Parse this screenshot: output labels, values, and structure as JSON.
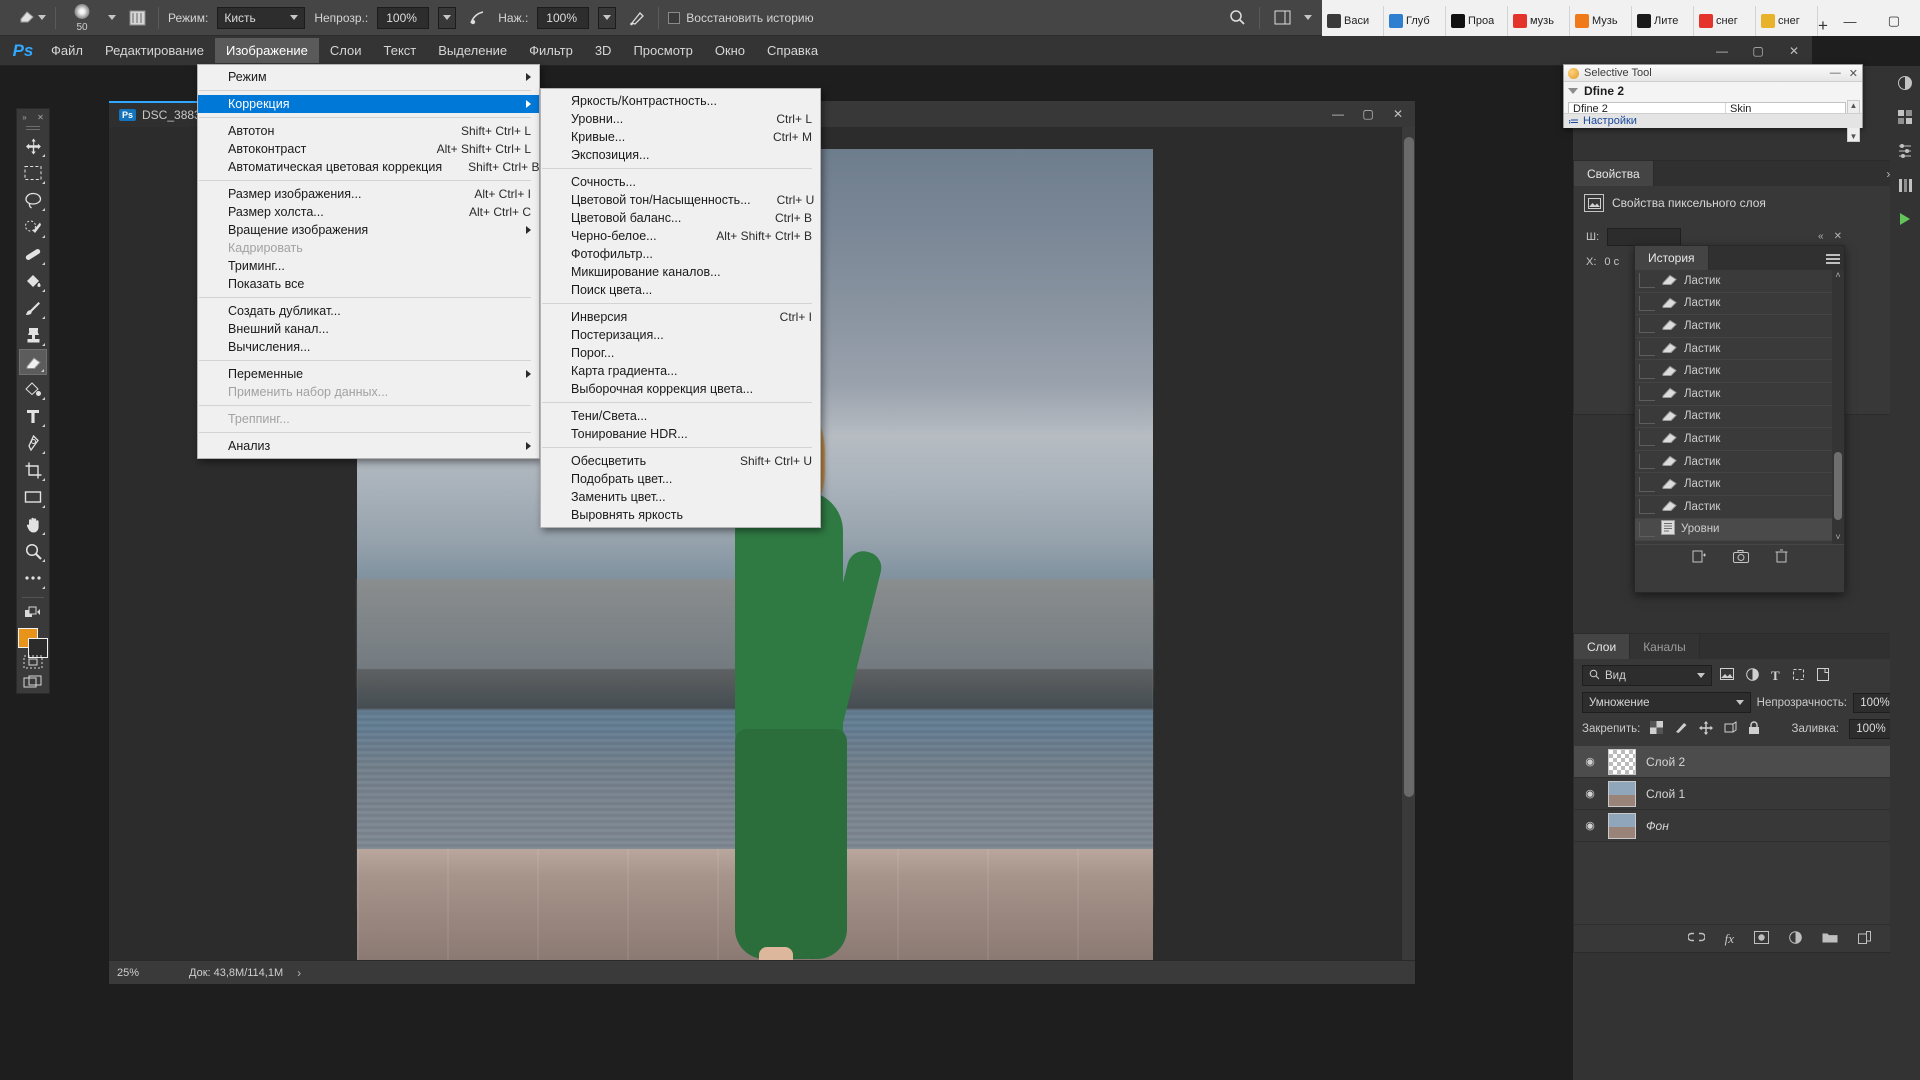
{
  "browser": {
    "tabs": [
      {
        "label": "Васи",
        "color": "#3a3a3a"
      },
      {
        "label": "Глуб",
        "color": "#2f7fd0"
      },
      {
        "label": "Проа",
        "color": "#111111"
      },
      {
        "label": "музь",
        "color": "#e4332a"
      },
      {
        "label": "Музь",
        "color": "#f07a1a"
      },
      {
        "label": "Лите",
        "color": "#1a1a1a"
      },
      {
        "label": "снег",
        "color": "#e4332a"
      },
      {
        "label": "снег",
        "color": "#e8b22a"
      }
    ],
    "new_tab": "+",
    "minimize": "—",
    "maximize": "▢",
    "close": "✕"
  },
  "options_bar": {
    "tool_icon": "eraser-tool-icon",
    "brush_size": "50",
    "mode_label": "Режим:",
    "mode_value": "Кисть",
    "opacity_label": "Непрозр.:",
    "opacity_value": "100%",
    "pressure_opacity_icon": "pressure-opacity-icon",
    "flow_label": "Наж.:",
    "flow_value": "100%",
    "airbrush_icon": "airbrush-icon",
    "restore_history_label": "Восстановить историю",
    "search_icon": "search-icon",
    "workspace_icon": "workspace-icon"
  },
  "menubar": {
    "logo": "Ps",
    "items": [
      "Файл",
      "Редактирование",
      "Изображение",
      "Слои",
      "Текст",
      "Выделение",
      "Фильтр",
      "3D",
      "Просмотр",
      "Окно",
      "Справка"
    ],
    "active_index": 2,
    "window_buttons": [
      "—",
      "▢",
      "✕"
    ]
  },
  "image_menu": {
    "groups": [
      [
        {
          "label": "Режим",
          "shortcut": "",
          "submenu": true,
          "disabled": false,
          "highlighted": false
        }
      ],
      [
        {
          "label": "Коррекция",
          "shortcut": "",
          "submenu": true,
          "disabled": false,
          "highlighted": true
        }
      ],
      [
        {
          "label": "Автотон",
          "shortcut": "Shift+ Ctrl+ L",
          "submenu": false,
          "disabled": false,
          "highlighted": false
        },
        {
          "label": "Автоконтраст",
          "shortcut": "Alt+ Shift+ Ctrl+ L",
          "submenu": false,
          "disabled": false,
          "highlighted": false
        },
        {
          "label": "Автоматическая цветовая коррекция",
          "shortcut": "Shift+ Ctrl+ B",
          "submenu": false,
          "disabled": false,
          "highlighted": false
        }
      ],
      [
        {
          "label": "Размер изображения...",
          "shortcut": "Alt+ Ctrl+ I",
          "submenu": false,
          "disabled": false,
          "highlighted": false
        },
        {
          "label": "Размер холста...",
          "shortcut": "Alt+ Ctrl+ C",
          "submenu": false,
          "disabled": false,
          "highlighted": false
        },
        {
          "label": "Вращение изображения",
          "shortcut": "",
          "submenu": true,
          "disabled": false,
          "highlighted": false
        },
        {
          "label": "Кадрировать",
          "shortcut": "",
          "submenu": false,
          "disabled": true,
          "highlighted": false
        },
        {
          "label": "Триминг...",
          "shortcut": "",
          "submenu": false,
          "disabled": false,
          "highlighted": false
        },
        {
          "label": "Показать все",
          "shortcut": "",
          "submenu": false,
          "disabled": false,
          "highlighted": false
        }
      ],
      [
        {
          "label": "Создать дубликат...",
          "shortcut": "",
          "submenu": false,
          "disabled": false,
          "highlighted": false
        },
        {
          "label": "Внешний канал...",
          "shortcut": "",
          "submenu": false,
          "disabled": false,
          "highlighted": false
        },
        {
          "label": "Вычисления...",
          "shortcut": "",
          "submenu": false,
          "disabled": false,
          "highlighted": false
        }
      ],
      [
        {
          "label": "Переменные",
          "shortcut": "",
          "submenu": true,
          "disabled": false,
          "highlighted": false
        },
        {
          "label": "Применить набор данных...",
          "shortcut": "",
          "submenu": false,
          "disabled": true,
          "highlighted": false
        }
      ],
      [
        {
          "label": "Треппинг...",
          "shortcut": "",
          "submenu": false,
          "disabled": true,
          "highlighted": false
        }
      ],
      [
        {
          "label": "Анализ",
          "shortcut": "",
          "submenu": true,
          "disabled": false,
          "highlighted": false
        }
      ]
    ]
  },
  "adjustments_submenu": {
    "groups": [
      [
        {
          "label": "Яркость/Контрастность...",
          "shortcut": ""
        },
        {
          "label": "Уровни...",
          "shortcut": "Ctrl+ L"
        },
        {
          "label": "Кривые...",
          "shortcut": "Ctrl+ M"
        },
        {
          "label": "Экспозиция...",
          "shortcut": ""
        }
      ],
      [
        {
          "label": "Сочность...",
          "shortcut": ""
        },
        {
          "label": "Цветовой тон/Насыщенность...",
          "shortcut": "Ctrl+ U"
        },
        {
          "label": "Цветовой баланс...",
          "shortcut": "Ctrl+ B"
        },
        {
          "label": "Черно-белое...",
          "shortcut": "Alt+ Shift+ Ctrl+ B"
        },
        {
          "label": "Фотофильтр...",
          "shortcut": ""
        },
        {
          "label": "Микширование каналов...",
          "shortcut": ""
        },
        {
          "label": "Поиск цвета...",
          "shortcut": ""
        }
      ],
      [
        {
          "label": "Инверсия",
          "shortcut": "Ctrl+ I"
        },
        {
          "label": "Постеризация...",
          "shortcut": ""
        },
        {
          "label": "Порог...",
          "shortcut": ""
        },
        {
          "label": "Карта градиента...",
          "shortcut": ""
        },
        {
          "label": "Выборочная коррекция цвета...",
          "shortcut": ""
        }
      ],
      [
        {
          "label": "Тени/Света...",
          "shortcut": ""
        },
        {
          "label": "Тонирование HDR...",
          "shortcut": ""
        }
      ],
      [
        {
          "label": "Обесцветить",
          "shortcut": "Shift+ Ctrl+ U"
        },
        {
          "label": "Подобрать цвет...",
          "shortcut": ""
        },
        {
          "label": "Заменить цвет...",
          "shortcut": ""
        },
        {
          "label": "Выровнять яркость",
          "shortcut": ""
        }
      ]
    ]
  },
  "toolbar": {
    "collapse_icon": "collapse-panel-icon",
    "close_icon": "close-icon",
    "tools": [
      {
        "name": "move-tool",
        "selected": false
      },
      {
        "name": "rectangular-marquee-tool",
        "selected": false
      },
      {
        "name": "lasso-tool",
        "selected": false
      },
      {
        "name": "quick-selection-tool",
        "selected": false
      },
      {
        "name": "healing-brush-tool",
        "selected": false
      },
      {
        "name": "paint-bucket-gradient-tool",
        "selected": false
      },
      {
        "name": "brush-tool",
        "selected": false
      },
      {
        "name": "clone-stamp-tool",
        "selected": false
      },
      {
        "name": "eraser-tool",
        "selected": true
      },
      {
        "name": "gradient-tool",
        "selected": false
      },
      {
        "name": "type-tool",
        "selected": false
      },
      {
        "name": "pen-tool",
        "selected": false
      },
      {
        "name": "crop-tool",
        "selected": false
      },
      {
        "name": "shape-tool",
        "selected": false
      },
      {
        "name": "hand-tool",
        "selected": false
      },
      {
        "name": "zoom-tool",
        "selected": false
      },
      {
        "name": "more-tools",
        "selected": false
      }
    ],
    "foreground_color": "#e8941a",
    "background_color": "#2b2b2b",
    "quickmask_icon": "quick-mask-icon",
    "screenmode_icon": "screen-mode-icon"
  },
  "document": {
    "tab_badge": "Ps",
    "tab_title": "DSC_3883.jp",
    "window_buttons": [
      "—",
      "▢",
      "✕"
    ],
    "zoom": "25%",
    "doc_info": "Док: 43,8М/114,1М",
    "status_arrow": "›"
  },
  "selective_tool": {
    "title": "Selective Tool",
    "minimize": "—",
    "close": "✕",
    "group_name": "Dfine 2",
    "table_col1": "Dfine 2",
    "table_col2": "Skin",
    "settings_label": "Настройки",
    "settings_icon": "settings-list-icon"
  },
  "properties": {
    "tab_label": "Свойства",
    "collapse_icon": "collapse-icon",
    "menu_icon": "panel-menu-icon",
    "header": "Свойства пиксельного слоя",
    "header_icon": "pixel-layer-icon",
    "width_label": "Ш:",
    "x_label": "X:",
    "x_value": "0 c"
  },
  "history": {
    "tab_label": "История",
    "menu_icon": "panel-menu-icon",
    "collapse_icon": "collapse-icon",
    "close_icon": "close-icon",
    "items": [
      {
        "label": "Ластик",
        "icon": "eraser-icon",
        "current": false
      },
      {
        "label": "Ластик",
        "icon": "eraser-icon",
        "current": false
      },
      {
        "label": "Ластик",
        "icon": "eraser-icon",
        "current": false
      },
      {
        "label": "Ластик",
        "icon": "eraser-icon",
        "current": false
      },
      {
        "label": "Ластик",
        "icon": "eraser-icon",
        "current": false
      },
      {
        "label": "Ластик",
        "icon": "eraser-icon",
        "current": false
      },
      {
        "label": "Ластик",
        "icon": "eraser-icon",
        "current": false
      },
      {
        "label": "Ластик",
        "icon": "eraser-icon",
        "current": false
      },
      {
        "label": "Ластик",
        "icon": "eraser-icon",
        "current": false
      },
      {
        "label": "Ластик",
        "icon": "eraser-icon",
        "current": false
      },
      {
        "label": "Ластик",
        "icon": "eraser-icon",
        "current": false
      },
      {
        "label": "Уровни",
        "icon": "levels-icon",
        "current": true
      }
    ],
    "footer_icons": [
      "new-document-from-state-icon",
      "new-snapshot-icon",
      "delete-icon"
    ]
  },
  "layers": {
    "tabs": [
      {
        "label": "Слои",
        "active": true
      },
      {
        "label": "Каналы",
        "active": false
      }
    ],
    "menu_icon": "panel-menu-icon",
    "filter_placeholder": "Вид",
    "filter_search_icon": "search-icon",
    "filter_icons": [
      "pixel-filter-icon",
      "adjustment-filter-icon",
      "type-filter-icon",
      "shape-filter-icon",
      "smart-object-filter-icon"
    ],
    "filter_toggle_icon": "filter-toggle-icon",
    "blend_mode": "Умножение",
    "opacity_label": "Непрозрачность:",
    "opacity_value": "100%",
    "lock_label": "Закрепить:",
    "lock_icons": [
      "lock-transparent-icon",
      "lock-image-icon",
      "lock-position-icon",
      "lock-artboard-icon",
      "lock-all-icon"
    ],
    "fill_label": "Заливка:",
    "fill_value": "100%",
    "items": [
      {
        "name": "Слой 2",
        "selected": true,
        "visible": true,
        "thumb": "checker",
        "locked": false,
        "italic": false
      },
      {
        "name": "Слой 1",
        "selected": false,
        "visible": true,
        "thumb": "photo",
        "locked": false,
        "italic": false
      },
      {
        "name": "Фон",
        "selected": false,
        "visible": true,
        "thumb": "photo",
        "locked": true,
        "italic": true
      }
    ],
    "eye_icon": "eye-icon",
    "lock_badge_icon": "lock-icon",
    "footer_icons": [
      "link-layers-icon",
      "layer-style-icon",
      "layer-mask-icon",
      "adjustment-layer-icon",
      "new-group-icon",
      "new-layer-icon",
      "delete-layer-icon"
    ]
  },
  "right_rail": {
    "icons": [
      "color-panel-icon",
      "swatches-panel-icon",
      "adjustments-panel-icon",
      "libraries-panel-icon",
      "nik-collection-icon"
    ]
  },
  "colors": {
    "accent": "#0078d7",
    "panel_bg": "#383838",
    "menu_bg": "#f0f0f0",
    "canvas_bg": "#2c2c2c",
    "foreground": "#e8941a"
  }
}
